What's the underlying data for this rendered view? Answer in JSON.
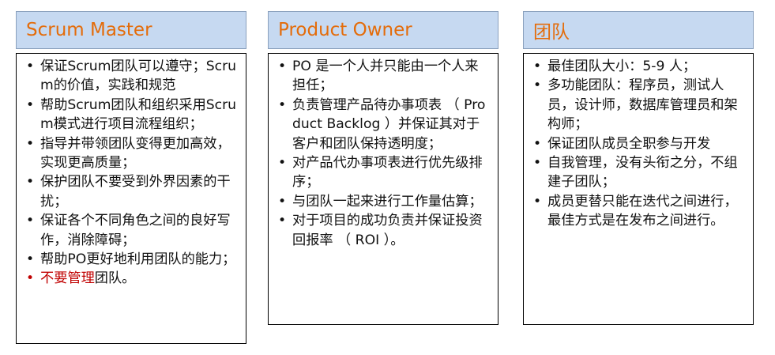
{
  "columns": [
    {
      "title": "Scrum Master",
      "items": [
        "保证Scrum团队可以遵守；Scrum的价值，实践和规范",
        "帮助Scrum团队和组织采用Scrum模式进行项目流程组织；",
        "指导并带领团队变得更加高效，实现更高质量；",
        "保护团队不要受到外界因素的干扰；",
        "保证各个不同角色之间的良好写作，消除障碍；",
        "帮助PO更好地利用团队的能力；"
      ],
      "last_item": {
        "highlight": "不要管理",
        "rest": "团队。"
      }
    },
    {
      "title": "Product Owner",
      "items": [
        "PO 是一个人并只能由一个人来担任；",
        "负责管理产品待办事项表 （ Product Backlog ）并保证其对于客户和团队保持透明度；",
        "对产品代办事项表进行优先级排序；",
        "与团队一起来进行工作量估算；",
        "对于项目的成功负责并保证投资回报率 （ ROI ）。"
      ]
    },
    {
      "title": "团队",
      "items": [
        "最佳团队大小：5-9 人；",
        "多功能团队：程序员，测试人员，设计师，数据库管理员和架构师；",
        "保证团队成员全职参与开发",
        "自我管理，没有头衔之分，不组建子团队；",
        "成员更替只能在迭代之间进行，最佳方式是在发布之间进行。"
      ]
    }
  ],
  "bullet_char": "•",
  "colors": {
    "header_bg": "#c6d9f1",
    "header_text": "#e46c0a",
    "highlight": "#c00000"
  }
}
